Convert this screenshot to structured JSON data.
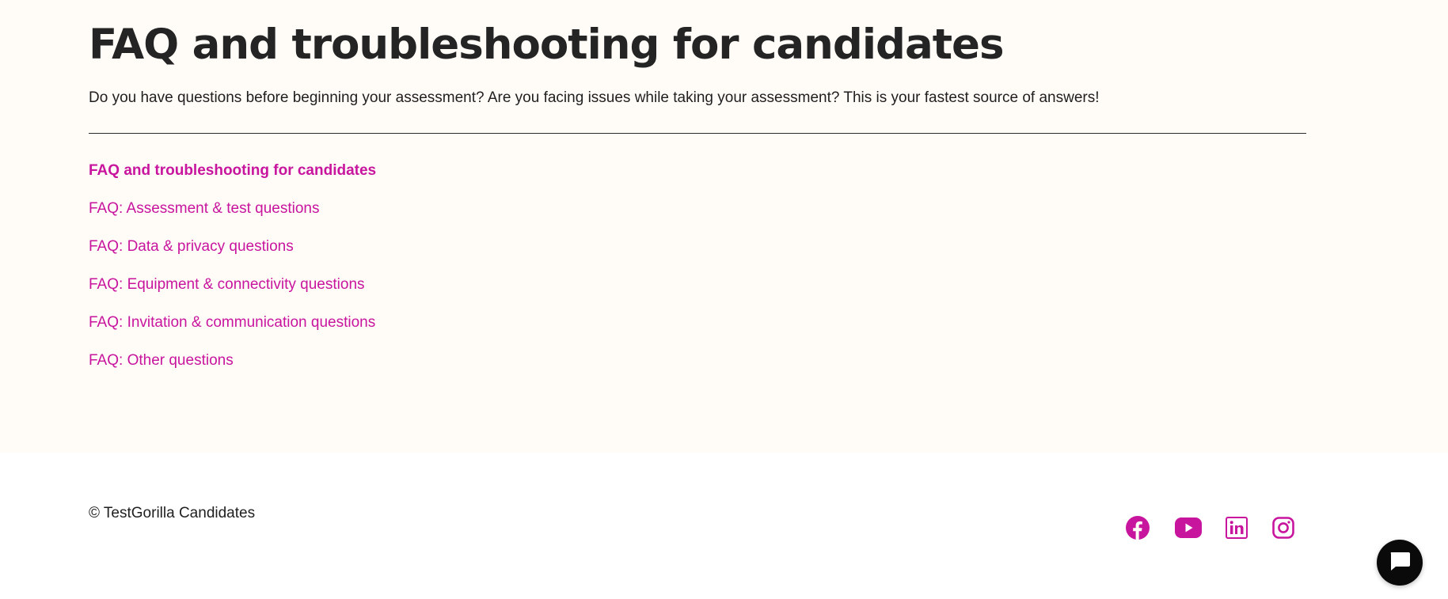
{
  "header": {
    "title": "FAQ and troubleshooting for candidates",
    "subtitle": "Do you have questions before beginning your assessment? Are you facing issues while taking your assessment? This is your fastest source of answers!"
  },
  "nav": {
    "items": [
      {
        "label": "FAQ and troubleshooting for candidates",
        "active": true
      },
      {
        "label": "FAQ: Assessment & test questions",
        "active": false
      },
      {
        "label": "FAQ: Data & privacy questions",
        "active": false
      },
      {
        "label": "FAQ: Equipment & connectivity questions",
        "active": false
      },
      {
        "label": "FAQ: Invitation & communication questions",
        "active": false
      },
      {
        "label": "FAQ: Other questions",
        "active": false
      }
    ]
  },
  "footer": {
    "copyright": "© TestGorilla Candidates",
    "social": [
      {
        "icon": "facebook-icon"
      },
      {
        "icon": "youtube-icon"
      },
      {
        "icon": "linkedin-icon"
      },
      {
        "icon": "instagram-icon"
      }
    ],
    "chat_icon": "chat-bubble-icon"
  },
  "colors": {
    "accent": "#c8159e",
    "hero_background": "#fffbf7",
    "text": "#1f1f1f",
    "chat_button": "#0a0a0a"
  }
}
